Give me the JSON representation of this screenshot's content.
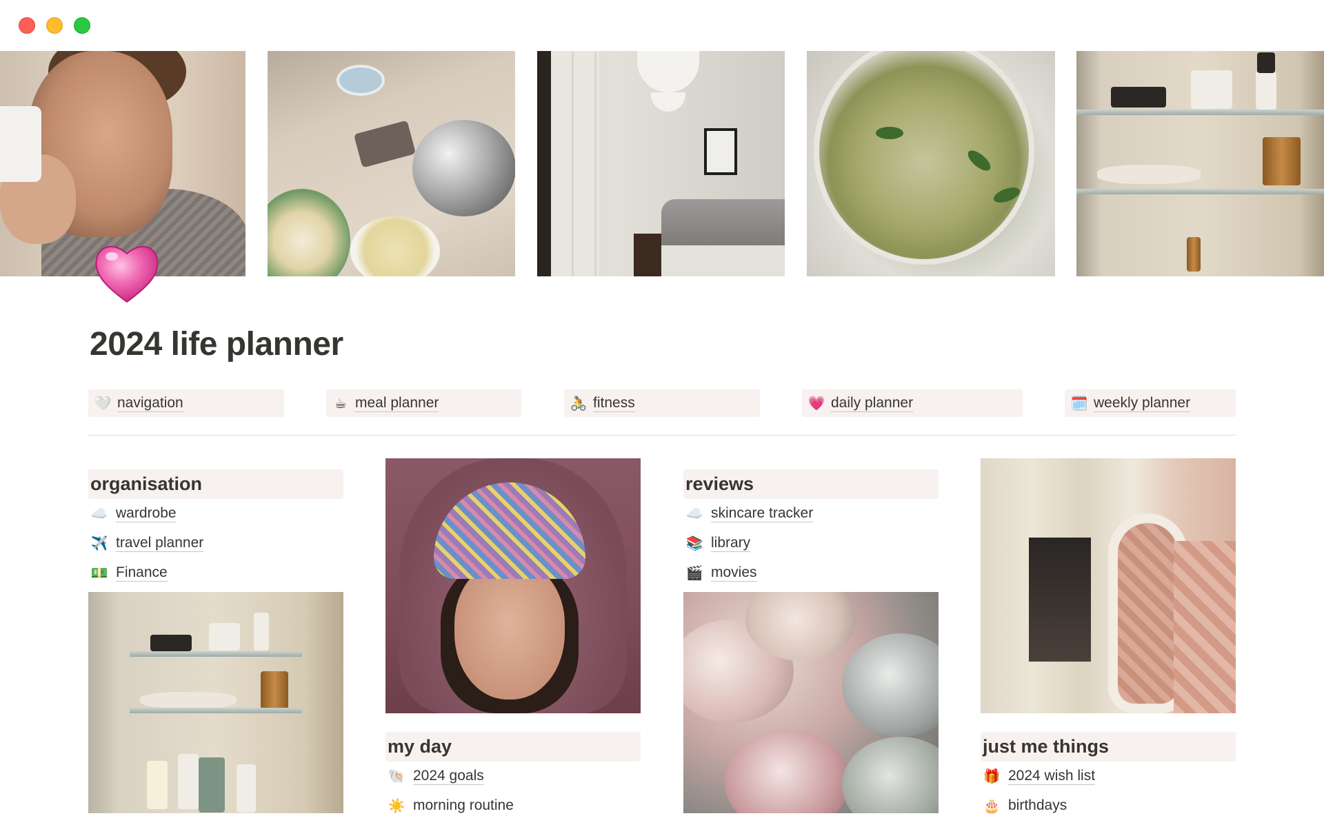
{
  "page": {
    "title": "2024 life planner",
    "icon": "pink-heart-emoji"
  },
  "quick_links": [
    {
      "emoji": "🤍",
      "icon": "white-heart-icon",
      "label": "navigation"
    },
    {
      "emoji": "☕",
      "icon": "coffee-icon",
      "label": "meal planner"
    },
    {
      "emoji": "🚴",
      "icon": "cyclist-icon",
      "label": "fitness"
    },
    {
      "emoji": "💗",
      "icon": "pink-heart-icon",
      "label": "daily planner"
    },
    {
      "emoji": "🗓️",
      "icon": "calendar-icon",
      "label": "weekly planner"
    }
  ],
  "organisation": {
    "header": "organisation",
    "items": [
      {
        "emoji": "☁️",
        "icon": "cloud-icon",
        "label": "wardrobe"
      },
      {
        "emoji": "✈️",
        "icon": "airplane-icon",
        "label": "travel planner"
      },
      {
        "emoji": "💵",
        "icon": "money-icon",
        "label": "Finance"
      }
    ]
  },
  "my_day": {
    "header": "my day",
    "items": [
      {
        "emoji": "🐚",
        "icon": "shell-icon",
        "label": "2024 goals"
      },
      {
        "emoji": "☀️",
        "icon": "sun-icon",
        "label": "morning routine"
      }
    ]
  },
  "reviews": {
    "header": "reviews",
    "items": [
      {
        "emoji": "☁️",
        "icon": "cloud-icon",
        "label": "skincare tracker"
      },
      {
        "emoji": "📚",
        "icon": "books-icon",
        "label": "library"
      },
      {
        "emoji": "🎬",
        "icon": "clapper-icon",
        "label": "movies"
      }
    ]
  },
  "just_me_things": {
    "header": "just me things",
    "items": [
      {
        "emoji": "🎁",
        "icon": "gift-icon",
        "label": "2024 wish list"
      },
      {
        "emoji": "🎂",
        "icon": "cake-icon",
        "label": "birthdays"
      }
    ]
  },
  "colors": {
    "block_background": "#f7f1f0",
    "text": "#37352f",
    "divider": "#dcdad7"
  }
}
